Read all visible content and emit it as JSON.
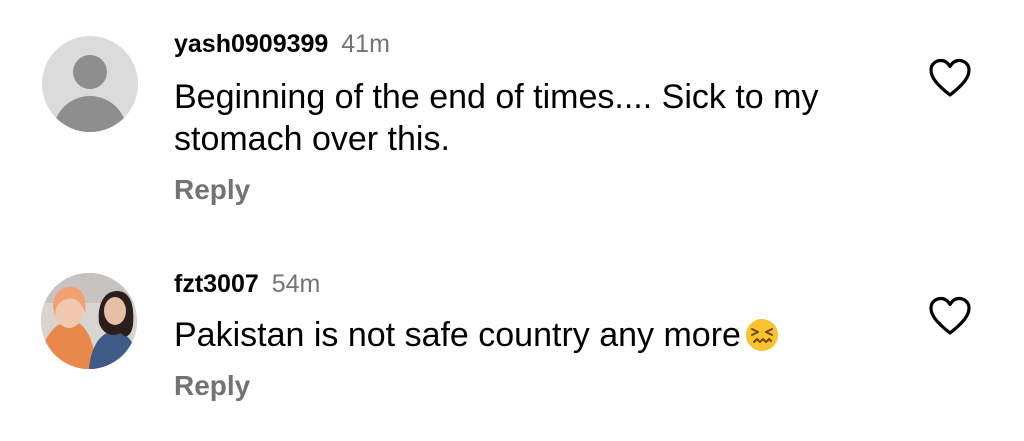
{
  "comments": [
    {
      "username": "yash0909399",
      "time": "41m",
      "text": "Beginning of the end of times.... Sick to my stomach over this.",
      "reply_label": "Reply",
      "avatar": "default-avatar-icon",
      "like_icon": "heart-outline-icon"
    },
    {
      "username": "fzt3007",
      "time": "54m",
      "text": "Pakistan is not safe country any more",
      "emoji": "confounded-face-emoji",
      "reply_label": "Reply",
      "avatar": "profile-photo",
      "like_icon": "heart-outline-icon"
    }
  ],
  "colors": {
    "text": "#000000",
    "secondary_text": "#737373",
    "background": "#ffffff"
  }
}
